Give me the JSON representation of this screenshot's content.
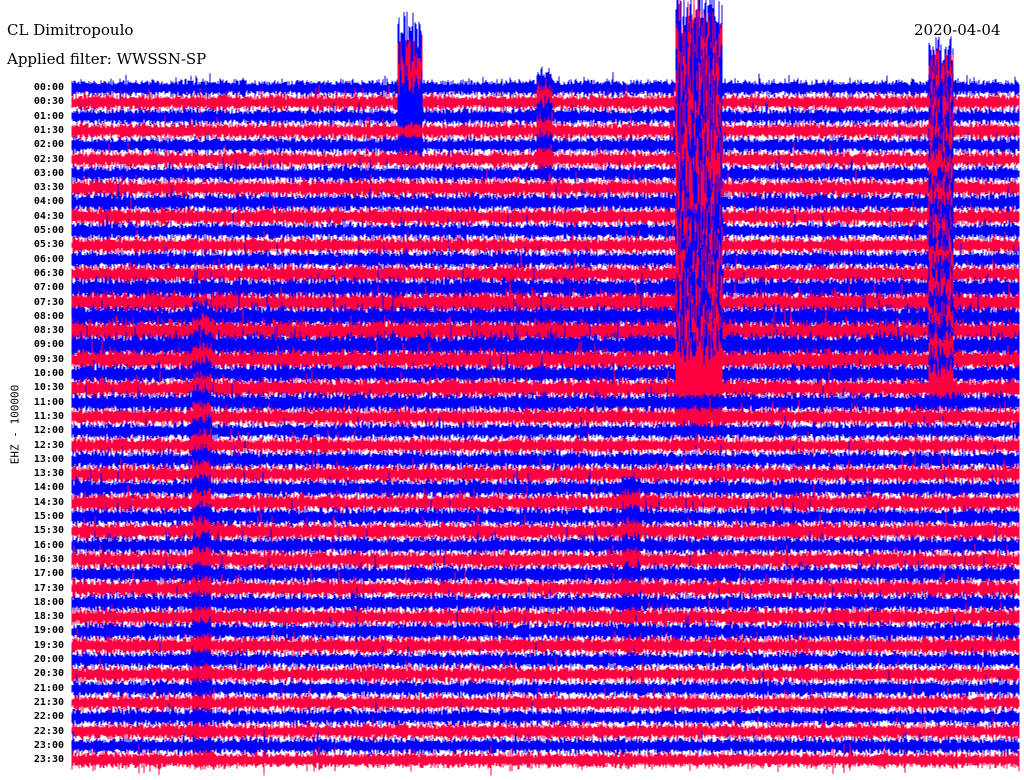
{
  "header": {
    "station": "CL Dimitropoulo",
    "filter": "Applied filter: WWSSN-SP",
    "date": "2020-04-04"
  },
  "chart_data": {
    "type": "helicorder",
    "title": "CL Dimitropoulo",
    "ylabel": "EHZ - 100000",
    "minutes_per_line": 30,
    "colors": [
      "#0000ff",
      "#ff0040"
    ],
    "row_labels": [
      "00:00",
      "00:30",
      "01:00",
      "01:30",
      "02:00",
      "02:30",
      "03:00",
      "03:30",
      "04:00",
      "04:30",
      "05:00",
      "05:30",
      "06:00",
      "06:30",
      "07:00",
      "07:30",
      "08:00",
      "08:30",
      "09:00",
      "09:30",
      "10:00",
      "10:30",
      "11:00",
      "11:30",
      "12:00",
      "12:30",
      "13:00",
      "13:30",
      "14:00",
      "14:30",
      "15:00",
      "15:30",
      "16:00",
      "16:30",
      "17:00",
      "17:30",
      "18:00",
      "18:30",
      "19:00",
      "19:30",
      "20:00",
      "20:30",
      "21:00",
      "21:30",
      "22:00",
      "22:30",
      "23:00",
      "23:30"
    ],
    "noise_level": [
      1.0,
      1.0,
      1.0,
      1.0,
      1.0,
      1.0,
      1.0,
      1.1,
      1.1,
      1.1,
      1.0,
      1.0,
      1.1,
      1.1,
      1.3,
      1.3,
      1.4,
      1.4,
      1.5,
      1.3,
      1.2,
      1.2,
      1.2,
      1.1,
      1.0,
      1.0,
      1.1,
      1.1,
      1.1,
      1.1,
      1.1,
      1.1,
      1.1,
      1.1,
      1.1,
      1.1,
      1.1,
      1.1,
      1.1,
      1.1,
      1.0,
      1.0,
      1.0,
      1.0,
      1.0,
      1.0,
      1.0,
      1.0
    ],
    "events": [
      {
        "row_start": 0,
        "row_end": 21,
        "minute_start": 19.2,
        "minute_end": 20.3,
        "amplitude": 14
      },
      {
        "row_start": 0,
        "row_end": 2,
        "minute_start": 10.4,
        "minute_end": 10.8,
        "amplitude": 10
      },
      {
        "row_start": 0,
        "row_end": 21,
        "minute_start": 27.2,
        "minute_end": 27.6,
        "amplitude": 7
      },
      {
        "row_start": 0,
        "row_end": 5,
        "minute_start": 14.8,
        "minute_end": 14.9,
        "amplitude": 3
      },
      {
        "row_start": 16,
        "row_end": 47,
        "minute_start": 3.9,
        "minute_end": 4.1,
        "amplitude": 2.5
      },
      {
        "row_start": 28,
        "row_end": 40,
        "minute_start": 17.5,
        "minute_end": 17.7,
        "amplitude": 2
      }
    ]
  }
}
